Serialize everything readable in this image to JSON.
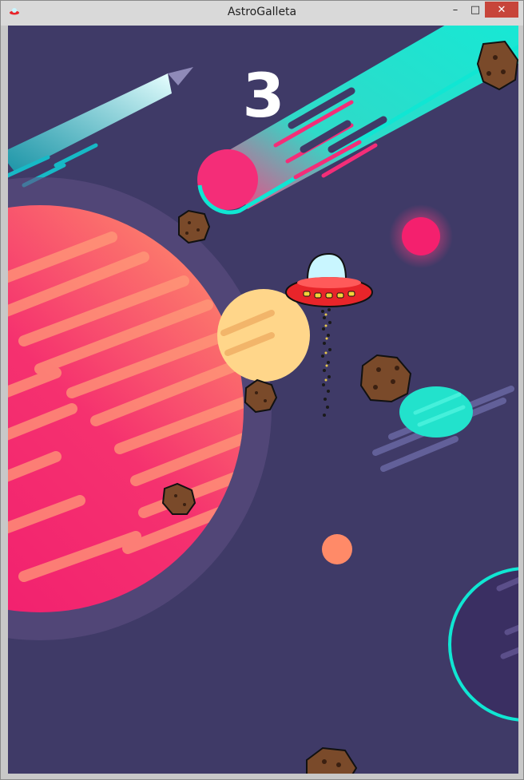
{
  "window": {
    "title": "AstroGalleta",
    "controls": {
      "minimize": "–",
      "maximize": "□",
      "close": "✕"
    }
  },
  "game": {
    "score": "3",
    "colors": {
      "background": "#3f3a67",
      "comet_cyan": "#10e6d3",
      "planet_pink": "#f02a7a",
      "planet_orange": "#ff8a68",
      "moon_yellow": "#ffd68a",
      "ufo_red": "#e8252a",
      "ufo_dome": "#c9f6ff",
      "cookie_brown": "#7a4a2a"
    }
  }
}
